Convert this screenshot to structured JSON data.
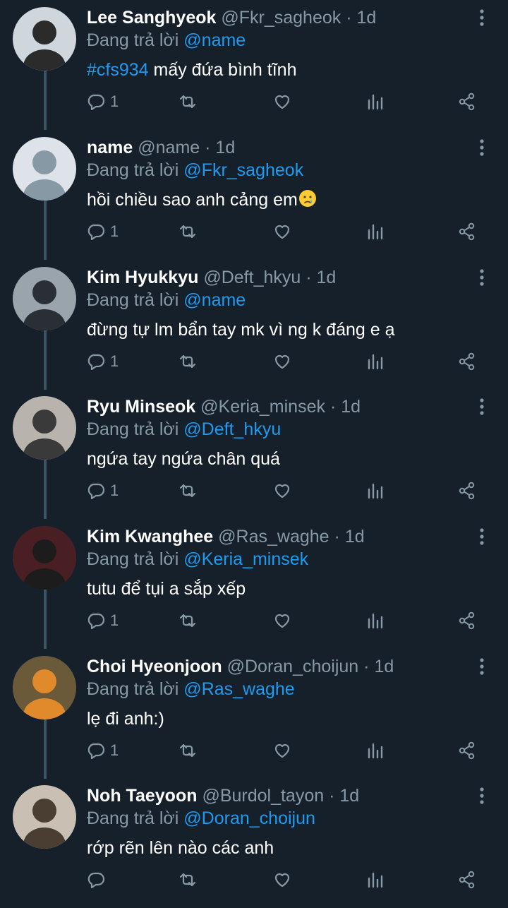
{
  "reply_prefix": "Đang trả lời",
  "colors": {
    "background": "#15202b",
    "muted": "#8899a6",
    "link": "#1d9bf0",
    "thread_line": "#3d5466"
  },
  "icons": [
    "reply-icon",
    "retweet-icon",
    "like-icon",
    "stats-icon",
    "share-icon",
    "more-options-icon"
  ],
  "tweets": [
    {
      "name": "Lee Sanghyeok",
      "handle": "@Fkr_sagheok",
      "time": "1d",
      "reply_to": "@name",
      "hashtag": "#cfs934",
      "text": " mấy đứa bình tĩnh",
      "replies": "1"
    },
    {
      "name": "name",
      "handle": "@name",
      "time": "1d",
      "reply_to": "@Fkr_sagheok",
      "hashtag": "",
      "text": "hồi chiều sao anh cảng em",
      "emoji": "crying-face-emoji",
      "replies": "1"
    },
    {
      "name": "Kim Hyukkyu",
      "handle": "@Deft_hkyu",
      "time": "1d",
      "reply_to": "@name",
      "hashtag": "",
      "text": "đừng tự lm bẩn tay mk vì ng k đáng e ạ",
      "replies": "1"
    },
    {
      "name": "Ryu Minseok",
      "handle": "@Keria_minsek",
      "time": "1d",
      "reply_to": "@Deft_hkyu",
      "hashtag": "",
      "text": "ngứa tay ngứa chân quá",
      "replies": "1"
    },
    {
      "name": "Kim Kwanghee",
      "handle": "@Ras_waghe",
      "time": "1d",
      "reply_to": "@Keria_minsek",
      "hashtag": "",
      "text": "tutu để tụi a sắp xếp",
      "replies": "1"
    },
    {
      "name": "Choi Hyeonjoon",
      "handle": "@Doran_choijun",
      "time": "1d",
      "reply_to": "@Ras_waghe",
      "hashtag": "",
      "text": "lẹ đi anh:)",
      "replies": "1"
    },
    {
      "name": "Noh Taeyoon",
      "handle": "@Burdol_tayon",
      "time": "1d",
      "reply_to": "@Doran_choijun",
      "hashtag": "",
      "text": "rớp rẽn lên nào các anh",
      "replies": ""
    }
  ]
}
